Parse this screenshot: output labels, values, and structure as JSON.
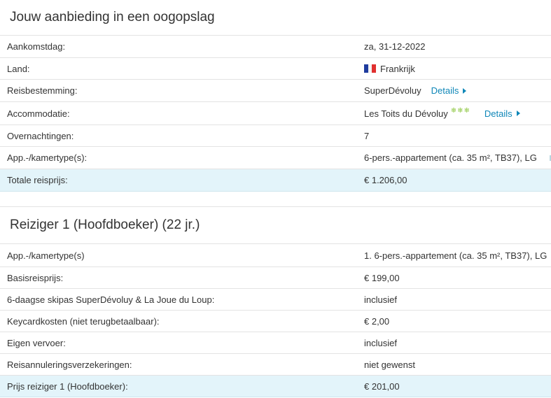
{
  "offer": {
    "title": "Jouw aanbieding in een oogopslag",
    "rows": [
      {
        "label": "Aankomstdag:",
        "value": "za, 31-12-2022"
      },
      {
        "label": "Land:",
        "value": "Frankrijk",
        "flag": "france-flag-icon"
      },
      {
        "label": "Reisbestemming:",
        "value": "SuperDévoluy",
        "link": "Details"
      },
      {
        "label": "Accommodatie:",
        "value": "Les Toits du Dévoluy",
        "stars": "❄❄❄",
        "link": "Details"
      },
      {
        "label": "Overnachtingen:",
        "value": "7"
      },
      {
        "label": "App.-/kamertype(s):",
        "value": "6-pers.-appartement (ca. 35 m², TB37), LG"
      }
    ],
    "total": {
      "label": "Totale reisprijs:",
      "value": "€ 1.206,00"
    }
  },
  "traveler": {
    "title": "Reiziger 1 (Hoofdboeker) (22 jr.)",
    "rows": [
      {
        "label": "App.-/kamertype(s)",
        "value": "1. 6-pers.-appartement (ca. 35 m², TB37), LG"
      },
      {
        "label": "Basisreisprijs:",
        "value": "€ 199,00"
      },
      {
        "label": "6-daagse skipas SuperDévoluy & La Joue du Loup:",
        "value": "inclusief"
      },
      {
        "label": "Keycardkosten (niet terugbetaalbaar):",
        "value": "€ 2,00"
      },
      {
        "label": "Eigen vervoer:",
        "value": "inclusief"
      },
      {
        "label": "Reisannuleringsverzekeringen:",
        "value": "niet gewenst"
      }
    ],
    "total": {
      "label": "Prijs reiziger 1 (Hoofdboeker):",
      "value": "€ 201,00"
    }
  },
  "colors": {
    "accent": "#0f87b8",
    "total_bg": "#e3f4fa",
    "stars": "#8cc63f"
  }
}
